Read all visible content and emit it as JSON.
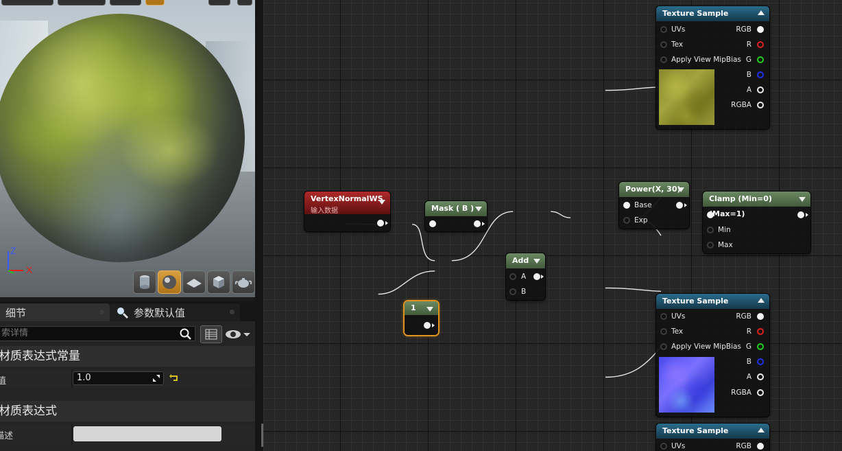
{
  "viewport": {
    "axis": {
      "z_label": "Z",
      "x_label": "X"
    },
    "mode_buttons": [
      {
        "icon": "cylinder-icon",
        "active": false
      },
      {
        "icon": "sphere-icon",
        "active": true
      },
      {
        "icon": "plane-icon",
        "active": false
      },
      {
        "icon": "cube-icon",
        "active": false
      },
      {
        "icon": "teapot-icon",
        "active": false
      }
    ]
  },
  "details_panel": {
    "tabs": [
      {
        "label": "细节",
        "active": true
      },
      {
        "label": "参数默认值",
        "active": false,
        "icon": "magnifier-icon"
      }
    ],
    "search_placeholder": "索详情",
    "categories": [
      {
        "title": "材质表达式常量",
        "properties": [
          {
            "label": "值",
            "value": "1.0"
          }
        ]
      },
      {
        "title": "材质表达式",
        "properties": [
          {
            "label": "描述",
            "value": ""
          }
        ]
      }
    ]
  },
  "graph": {
    "nodes": {
      "vertex_normal": {
        "title": "VertexNormalWS",
        "subtitle": "输入数据"
      },
      "mask": {
        "title": "Mask ( B )"
      },
      "add": {
        "title": "Add",
        "inputs": [
          "A",
          "B"
        ]
      },
      "constant": {
        "title": "1"
      },
      "power": {
        "title": "Power(X, 30)",
        "inputs": [
          "Base",
          "Exp"
        ]
      },
      "clamp": {
        "title": "Clamp (Min=0) (Max=1)",
        "inputs": [
          "Min",
          "Max"
        ]
      },
      "texture_sample_1": {
        "title": "Texture Sample",
        "inputs": [
          "UVs",
          "Tex",
          "Apply View MipBias"
        ],
        "outputs": [
          "RGB",
          "R",
          "G",
          "B",
          "A",
          "RGBA"
        ]
      },
      "texture_sample_2": {
        "title": "Texture Sample",
        "inputs": [
          "UVs",
          "Tex",
          "Apply View MipBias"
        ],
        "outputs": [
          "RGB",
          "R",
          "G",
          "B",
          "A",
          "RGBA"
        ]
      },
      "texture_sample_3": {
        "title": "Texture Sample",
        "inputs": [
          "UVs"
        ],
        "outputs": [
          "RGB"
        ]
      }
    },
    "colors": {
      "node_red": "#b02a2a",
      "node_green": "#5a7a52",
      "node_blue": "#1f5a78",
      "selection_orange": "#e0931e",
      "pin_r": "#e02020",
      "pin_g": "#20d020",
      "pin_b": "#2030f0"
    }
  }
}
